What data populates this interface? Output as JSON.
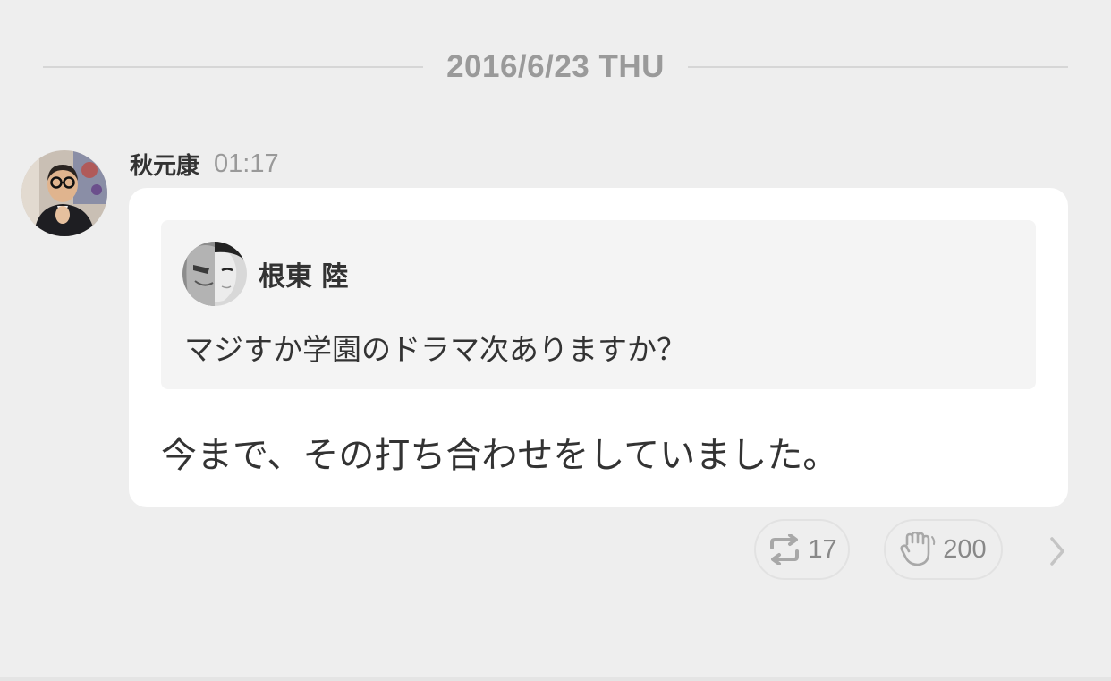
{
  "divider": {
    "date_label": "2016/6/23 THU"
  },
  "message": {
    "author": "秋元康",
    "time": "01:17",
    "avatar_icon": "author-avatar",
    "quote": {
      "author": "根東 陸",
      "avatar_icon": "quoted-user-avatar",
      "text": "マジすか学園のドラマ次ありますか？"
    },
    "reply": "今まで、その打ち合わせをしていました。"
  },
  "actions": {
    "retweet": {
      "icon": "retweet-icon",
      "count": "17"
    },
    "clap": {
      "icon": "clap-icon",
      "count": "200"
    },
    "more": {
      "icon": "chevron-right-icon"
    }
  },
  "colors": {
    "background": "#eeeeee",
    "bubble": "#ffffff",
    "quote_background": "#f4f4f4",
    "muted_text": "#999999",
    "primary_text": "#333333"
  }
}
